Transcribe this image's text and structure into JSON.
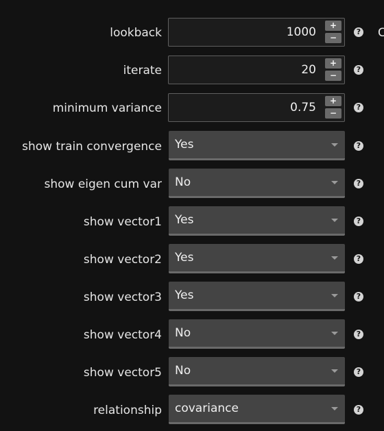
{
  "settings": [
    {
      "label": "lookback",
      "type": "number",
      "value": "1000",
      "help_icon": "question-circle-icon",
      "stepper_up": "+",
      "stepper_down": "−"
    },
    {
      "label": "iterate",
      "type": "number",
      "value": "20",
      "help_icon": "question-circle-icon",
      "stepper_up": "+",
      "stepper_down": "−"
    },
    {
      "label": "minimum variance",
      "type": "number",
      "value": "0.75",
      "help_icon": "question-circle-icon",
      "stepper_up": "+",
      "stepper_down": "−"
    },
    {
      "label": "show train convergence",
      "type": "select",
      "value": "Yes",
      "help_icon": "question-circle-icon"
    },
    {
      "label": "show eigen cum var",
      "type": "select",
      "value": "No",
      "help_icon": "question-circle-icon"
    },
    {
      "label": "show vector1",
      "type": "select",
      "value": "Yes",
      "help_icon": "question-circle-icon"
    },
    {
      "label": "show vector2",
      "type": "select",
      "value": "Yes",
      "help_icon": "question-circle-icon"
    },
    {
      "label": "show vector3",
      "type": "select",
      "value": "Yes",
      "help_icon": "question-circle-icon"
    },
    {
      "label": "show vector4",
      "type": "select",
      "value": "No",
      "help_icon": "question-circle-icon"
    },
    {
      "label": "show vector5",
      "type": "select",
      "value": "No",
      "help_icon": "question-circle-icon"
    },
    {
      "label": "relationship",
      "type": "select",
      "value": "covariance",
      "help_icon": "question-circle-icon"
    }
  ],
  "help_glyph": "?",
  "clipped_edge_text": "C",
  "colors": {
    "background": "#121212",
    "text": "#e6e6e6",
    "input_background": "#1c1c1c",
    "input_border": "#5f5f5f",
    "select_background": "#444444",
    "stepper_button": "#6a6a6a"
  }
}
